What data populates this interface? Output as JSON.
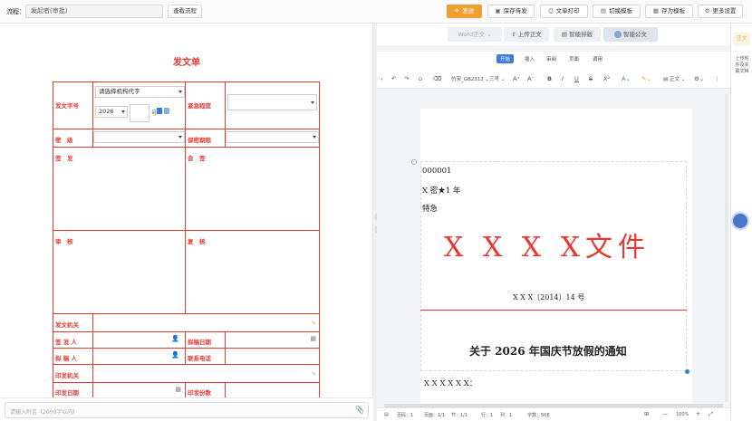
{
  "topbar": {
    "flow_label": "流程：",
    "flow_value": "发起者(审批)",
    "view_flow": "查看流程",
    "send": "发送",
    "save_draft": "保存待发",
    "print": "文单打印",
    "switch_template": "切换模板",
    "save_template": "存为模板",
    "more": "更多设置"
  },
  "form": {
    "title": "发文单",
    "doc_number_label": "发文字号",
    "org_code_placeholder": "请选择机构代字",
    "year": "2026",
    "hao": "号",
    "urgency_label": "紧急程度",
    "secret_label": "密　级",
    "secret_period_label": "保密期限",
    "sign_label": "签　发",
    "countersign_label": "会　签",
    "review_label": "审　核",
    "recheck_label": "复　核",
    "issuer_org_label": "发文机关",
    "signer_label": "签 发 人",
    "draft_date_label": "拟稿日期",
    "drafter_label": "拟 稿 人",
    "phone_label": "联系电话",
    "print_org_label": "印发机关",
    "print_date_label": "印发日期",
    "print_copies_label": "印发份数"
  },
  "attachment": {
    "placeholder": "请输入附言（2000字以内）"
  },
  "editor": {
    "tabs": [
      "Word正文",
      "上传正文",
      "智能排版",
      "智能公文"
    ],
    "menus": [
      "开始",
      "插入",
      "审阅",
      "页面",
      "调用"
    ],
    "font_name": "仿宋_GB2312",
    "font_size": "三号",
    "para_style": "正文",
    "doc": {
      "serial": "000001",
      "secret": "X 密★1 年",
      "urgent": "特急",
      "red_title": "X X X X文件",
      "doc_no": "X X X〔2014〕14 号",
      "headline": "关于 2026 年国庆节放假的通知",
      "addressee": "X X X X X X："
    },
    "status": {
      "page": "页码：1",
      "pages": "页面：1/1",
      "section": "节：1/1",
      "row": "行：1",
      "col": "列：1",
      "words": "字数：568",
      "zoom": "100%"
    }
  },
  "sidebar": {
    "zhengwen": "正文",
    "upload_attach": "上传附件及关联文档"
  },
  "colors": {
    "accent": "#f0a030",
    "red": "#e53935",
    "blue": "#3a7bd5"
  }
}
